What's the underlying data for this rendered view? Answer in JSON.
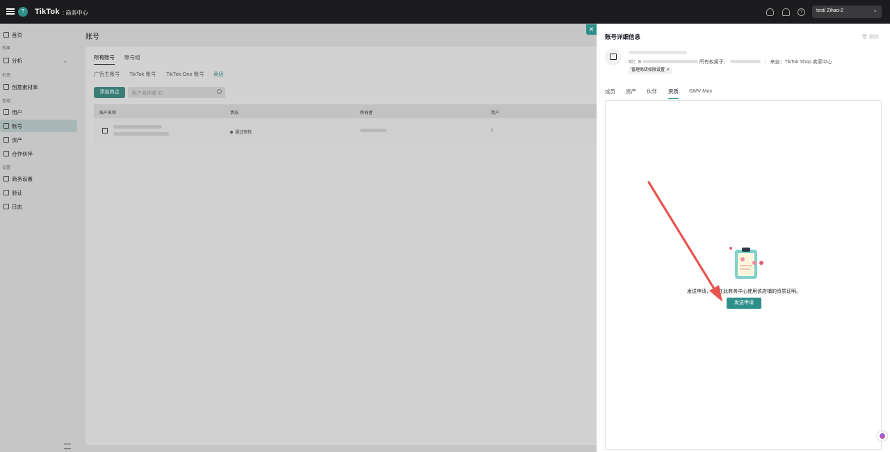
{
  "topbar": {
    "logo_initial": "T",
    "brand": "TikTok",
    "brand_sub": ": 商务中心",
    "help_glyph": "?",
    "user": "test/ Zihao-2",
    "icons": [
      "menu-icon",
      "lightbulb-icon",
      "bell-icon",
      "help-icon",
      "chevron-down-icon"
    ]
  },
  "sidebar": {
    "items": [
      {
        "label": "首页",
        "group": ""
      },
      {
        "group": "效果"
      },
      {
        "label": "分析"
      },
      {
        "group": "创意"
      },
      {
        "label": "创意素材库"
      },
      {
        "group": "管理"
      },
      {
        "label": "用户"
      },
      {
        "label": "账号"
      },
      {
        "label": "资产"
      },
      {
        "label": "合作伙伴"
      },
      {
        "group": "设置"
      },
      {
        "label": "商务设置"
      },
      {
        "label": "验证"
      },
      {
        "label": "日志"
      }
    ]
  },
  "main": {
    "title": "账号",
    "tabs": [
      "所有账号",
      "账号组"
    ],
    "subtabs": [
      "广告主账号",
      "TikTok 账号",
      "TikTok One 账号",
      "商店"
    ],
    "add_button": "添加商店",
    "search_placeholder": "账户名称或 ID",
    "columns": [
      "账户名称",
      "状态",
      "所有者",
      "用户"
    ],
    "row": {
      "status": "通过审核",
      "users": "1"
    }
  },
  "drawer": {
    "title": "账号详细信息",
    "delete": "删除",
    "id_label": "ID：",
    "id_value": "8",
    "owner_label": "所有权属于：",
    "source": "来自：TikTok Shop 卖家中心",
    "perm_button": "管理商店权限设置",
    "tabs": [
      "成员",
      "资产",
      "伙伴",
      "资质",
      "GMV Max"
    ],
    "active_tab": "资质",
    "empty_text_pre": "发送申请，",
    "empty_text_post": "在此商务中心使用该店铺的资质证明。",
    "send_button": "发送申请"
  },
  "colors": {
    "brand": "#2f8f8a",
    "topbar": "#1c1c1e",
    "arrow": "#e8544e"
  }
}
